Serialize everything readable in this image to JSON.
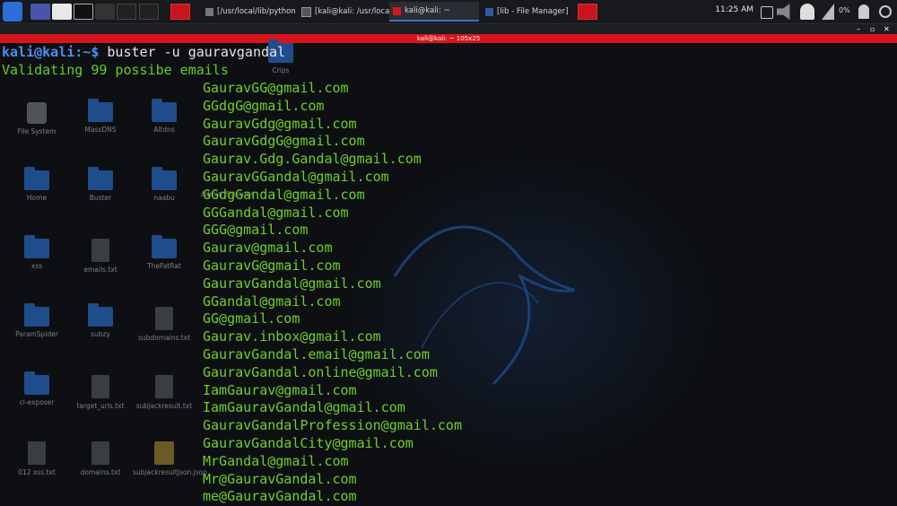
{
  "taskbar": {
    "tasks": [
      {
        "label": "[/usr/local/lib/python3.9..."
      },
      {
        "label": "[kali@kali: /usr/local/lib/..."
      },
      {
        "label": "kali@kali: ~"
      },
      {
        "label": "[lib - File Manager]"
      }
    ],
    "clock": "11:25 AM",
    "battery": "0%"
  },
  "terminal": {
    "title": "kali@kali: ~ 105x25",
    "prompt_user": "kali@kali",
    "prompt_path": ":~$ ",
    "command": "buster -u gauravgandal",
    "status": "Validating 99 possibe emails",
    "emails": [
      "GauravGG@gmail.com",
      "GGdgG@gmail.com",
      "GauravGdg@gmail.com",
      "GauravGdgG@gmail.com",
      "Gaurav.Gdg.Gandal@gmail.com",
      "GauravGGandal@gmail.com",
      "GGdgGandal@gmail.com",
      "GGGandal@gmail.com",
      "GGG@gmail.com",
      "Gaurav@gmail.com",
      "GauravG@gmail.com",
      "GauravGandal@gmail.com",
      "GGandal@gmail.com",
      "GG@gmail.com",
      "Gaurav.inbox@gmail.com",
      "GauravGandal.email@gmail.com",
      "GauravGandal.online@gmail.com",
      "IamGaurav@gmail.com",
      "IamGauravGandal@gmail.com",
      "GauravGandalProfession@gmail.com",
      "GauravGandalCity@gmail.com",
      "MrGandal@gmail.com",
      "Mr@GauravGandal.com",
      "me@GauravGandal.com"
    ]
  },
  "desktop": {
    "icons": [
      {
        "label": "Crips",
        "icon": "folder-icon"
      },
      {
        "label": "File System",
        "icon": "drive-icon"
      },
      {
        "label": "MassDNS",
        "icon": "folder-icon"
      },
      {
        "label": "Altdns",
        "icon": "folder-icon"
      },
      {
        "label": "Home",
        "icon": "home-folder-icon"
      },
      {
        "label": "Buster",
        "icon": "folder-icon"
      },
      {
        "label": "naabu",
        "icon": "locked-folder-icon"
      },
      {
        "label": "Admin_Scanner",
        "icon": "folder-icon"
      },
      {
        "label": "xss",
        "icon": "folder-icon"
      },
      {
        "label": "emails.txt",
        "icon": "text-file-icon"
      },
      {
        "label": "TheFatRat",
        "icon": "folder-icon"
      },
      {
        "label": "ParamSpider",
        "icon": "folder-icon"
      },
      {
        "label": "subzy",
        "icon": "folder-icon"
      },
      {
        "label": "subdomains.txt",
        "icon": "text-file-icon"
      },
      {
        "label": "cl-exposer",
        "icon": "folder-icon"
      },
      {
        "label": "target_urls.txt",
        "icon": "text-file-icon"
      },
      {
        "label": "subjackresult.txt",
        "icon": "text-file-icon"
      },
      {
        "label": "012 xss.txt",
        "icon": "text-file-icon"
      },
      {
        "label": "domains.txt",
        "icon": "text-file-icon"
      },
      {
        "label": "subjackresultJson.json",
        "icon": "json-file-icon"
      }
    ]
  },
  "colors": {
    "terminal_green": "#6ed126",
    "prompt_blue": "#4a8ff0",
    "title_red": "#d7141b"
  }
}
